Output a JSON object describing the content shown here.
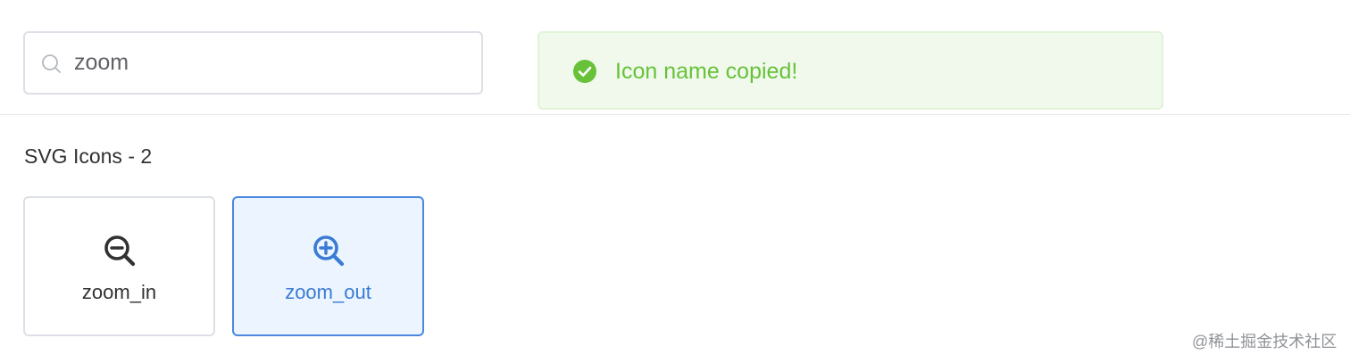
{
  "search": {
    "value": "zoom",
    "icon": "search-icon"
  },
  "toast": {
    "message": "Icon name copied!",
    "icon": "check-circle-icon",
    "color": "#67c23a"
  },
  "section": {
    "title": "SVG Icons - 2"
  },
  "icons": [
    {
      "label": "zoom_in",
      "icon": "zoom-minus-icon",
      "selected": false
    },
    {
      "label": "zoom_out",
      "icon": "zoom-plus-icon",
      "selected": true
    }
  ],
  "watermark": "@稀土掘金技术社区",
  "colors": {
    "accent": "#3a7bd5",
    "success": "#67c23a",
    "border": "#dcdfe6"
  }
}
